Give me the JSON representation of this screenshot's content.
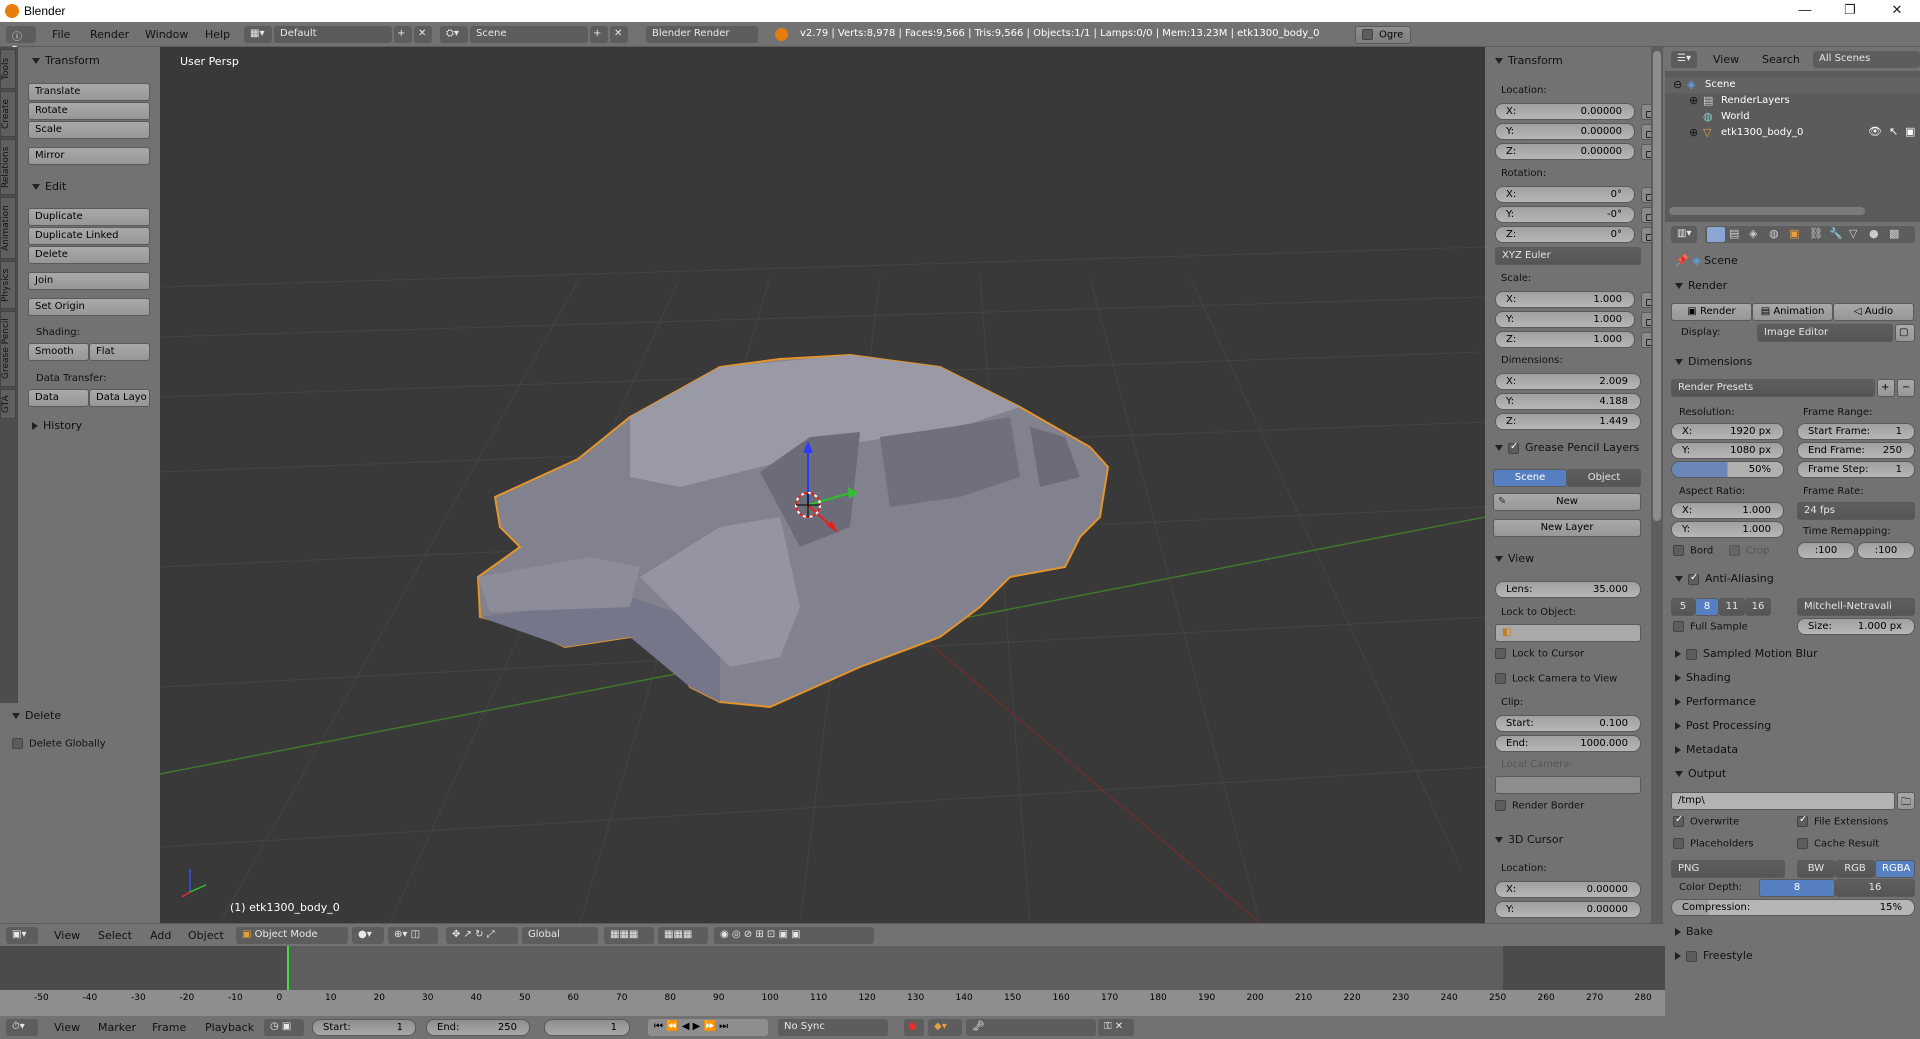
{
  "window": {
    "title": "Blender",
    "minimize": "—",
    "maximize": "❐",
    "close": "✕"
  },
  "topbar": {
    "menus": [
      "File",
      "Render",
      "Window",
      "Help"
    ],
    "layout": "Default",
    "scene": "Scene",
    "engine": "Blender Render",
    "stats": "v2.79 | Verts:8,978 | Faces:9,566 | Tris:9,566 | Objects:1/1 | Lamps:0/0 | Mem:13.23M | etk1300_body_0",
    "ogre": "Ogre"
  },
  "vtabs": [
    "Tools",
    "Create",
    "Relations",
    "Animation",
    "Physics",
    "Grease Pencil",
    "GTA"
  ],
  "tools": {
    "transform_hdr": "Transform",
    "translate": "Translate",
    "rotate": "Rotate",
    "scale": "Scale",
    "mirror": "Mirror",
    "edit_hdr": "Edit",
    "duplicate": "Duplicate",
    "duplicate_linked": "Duplicate Linked",
    "delete": "Delete",
    "join": "Join",
    "set_origin": "Set Origin",
    "shading": "Shading:",
    "smooth": "Smooth",
    "flat": "Flat",
    "data_transfer": "Data Transfer:",
    "data": "Data",
    "data_layo": "Data Layo",
    "history": "History"
  },
  "operator": {
    "hdr": "Delete",
    "delete_globally": "Delete Globally"
  },
  "viewport": {
    "label": "User Persp",
    "object": "(1) etk1300_body_0"
  },
  "nprops": {
    "transform": "Transform",
    "location": "Location:",
    "loc": [
      [
        "X:",
        "0.00000"
      ],
      [
        "Y:",
        "0.00000"
      ],
      [
        "Z:",
        "0.00000"
      ]
    ],
    "rotation": "Rotation:",
    "rot": [
      [
        "X:",
        "0°"
      ],
      [
        "Y:",
        "-0°"
      ],
      [
        "Z:",
        "0°"
      ]
    ],
    "euler": "XYZ Euler",
    "scale": "Scale:",
    "scl": [
      [
        "X:",
        "1.000"
      ],
      [
        "Y:",
        "1.000"
      ],
      [
        "Z:",
        "1.000"
      ]
    ],
    "dimensions": "Dimensions:",
    "dim": [
      [
        "X:",
        "2.009"
      ],
      [
        "Y:",
        "4.188"
      ],
      [
        "Z:",
        "1.449"
      ]
    ],
    "gp": "Grease Pencil Layers",
    "gp_scene": "Scene",
    "gp_object": "Object",
    "gp_new": "New",
    "gp_new_layer": "New Layer",
    "view": "View",
    "lens_l": "Lens:",
    "lens_v": "35.000",
    "lock_obj": "Lock to Object:",
    "lock_cursor": "Lock to Cursor",
    "lock_cam": "Lock Camera to View",
    "clip": "Clip:",
    "start_l": "Start:",
    "start_v": "0.100",
    "end_l": "End:",
    "end_v": "1000.000",
    "local_cam": "Local Camera:",
    "render_border": "Render Border",
    "cursor": "3D Cursor",
    "cur_loc": "Location:",
    "cur": [
      [
        "X:",
        "0.00000"
      ],
      [
        "Y:",
        "0.00000"
      ]
    ]
  },
  "outliner": {
    "view": "View",
    "search": "Search",
    "all_scenes": "All Scenes",
    "items": [
      "Scene",
      "RenderLayers",
      "World",
      "etk1300_body_0"
    ]
  },
  "properties": {
    "context": "Scene",
    "render": "Render",
    "btn_render": "Render",
    "btn_anim": "Animation",
    "btn_audio": "Audio",
    "display_l": "Display:",
    "display_v": "Image Editor",
    "dimensions": "Dimensions",
    "presets": "Render Presets",
    "resolution": "Resolution:",
    "res_x": "1920 px",
    "res_y": "1080 px",
    "res_pct": "50%",
    "frame_range": "Frame Range:",
    "start_frame": "Start Frame:",
    "start_frame_v": "1",
    "end_frame": "End Frame:",
    "end_frame_v": "250",
    "frame_step": "Frame Step:",
    "frame_step_v": "1",
    "aspect": "Aspect Ratio:",
    "asp_x": "1.000",
    "asp_y": "1.000",
    "frame_rate": "Frame Rate:",
    "fps": "24 fps",
    "bord": "Bord",
    "crop": "Crop",
    "time_remap": "Time Remapping:",
    "remap_a": ":100",
    "remap_b": ":100",
    "aa": "Anti-Aliasing",
    "aa_levels": [
      "5",
      "8",
      "11",
      "16"
    ],
    "aa_filter": "Mitchell-Netravali",
    "full_sample": "Full Sample",
    "size_l": "Size:",
    "size_v": "1.000 px",
    "sampled_mb": "Sampled Motion Blur",
    "shading": "Shading",
    "performance": "Performance",
    "post": "Post Processing",
    "metadata": "Metadata",
    "output": "Output",
    "path": "/tmp\\",
    "overwrite": "Overwrite",
    "file_ext": "File Extensions",
    "placeholders": "Placeholders",
    "cache": "Cache Result",
    "format": "PNG",
    "bw": "BW",
    "rgb": "RGB",
    "rgba": "RGBA",
    "color_depth": "Color Depth:",
    "cd8": "8",
    "cd16": "16",
    "compression": "Compression:",
    "comp_v": "15%",
    "bake": "Bake",
    "freestyle": "Freestyle"
  },
  "vp_header": {
    "view": "View",
    "select": "Select",
    "add": "Add",
    "object": "Object",
    "mode": "Object Mode",
    "orient": "Global"
  },
  "timeline": {
    "ticks": [
      "-50",
      "-40",
      "-30",
      "-20",
      "-10",
      "0",
      "10",
      "20",
      "30",
      "40",
      "50",
      "60",
      "70",
      "80",
      "90",
      "100",
      "110",
      "120",
      "130",
      "140",
      "150",
      "160",
      "170",
      "180",
      "190",
      "200",
      "210",
      "220",
      "230",
      "240",
      "250",
      "260",
      "270",
      "280"
    ],
    "view": "View",
    "marker": "Marker",
    "frame": "Frame",
    "playback": "Playback",
    "start_l": "Start:",
    "start_v": "1",
    "end_l": "End:",
    "end_v": "250",
    "cur": "1",
    "sync": "No Sync"
  }
}
